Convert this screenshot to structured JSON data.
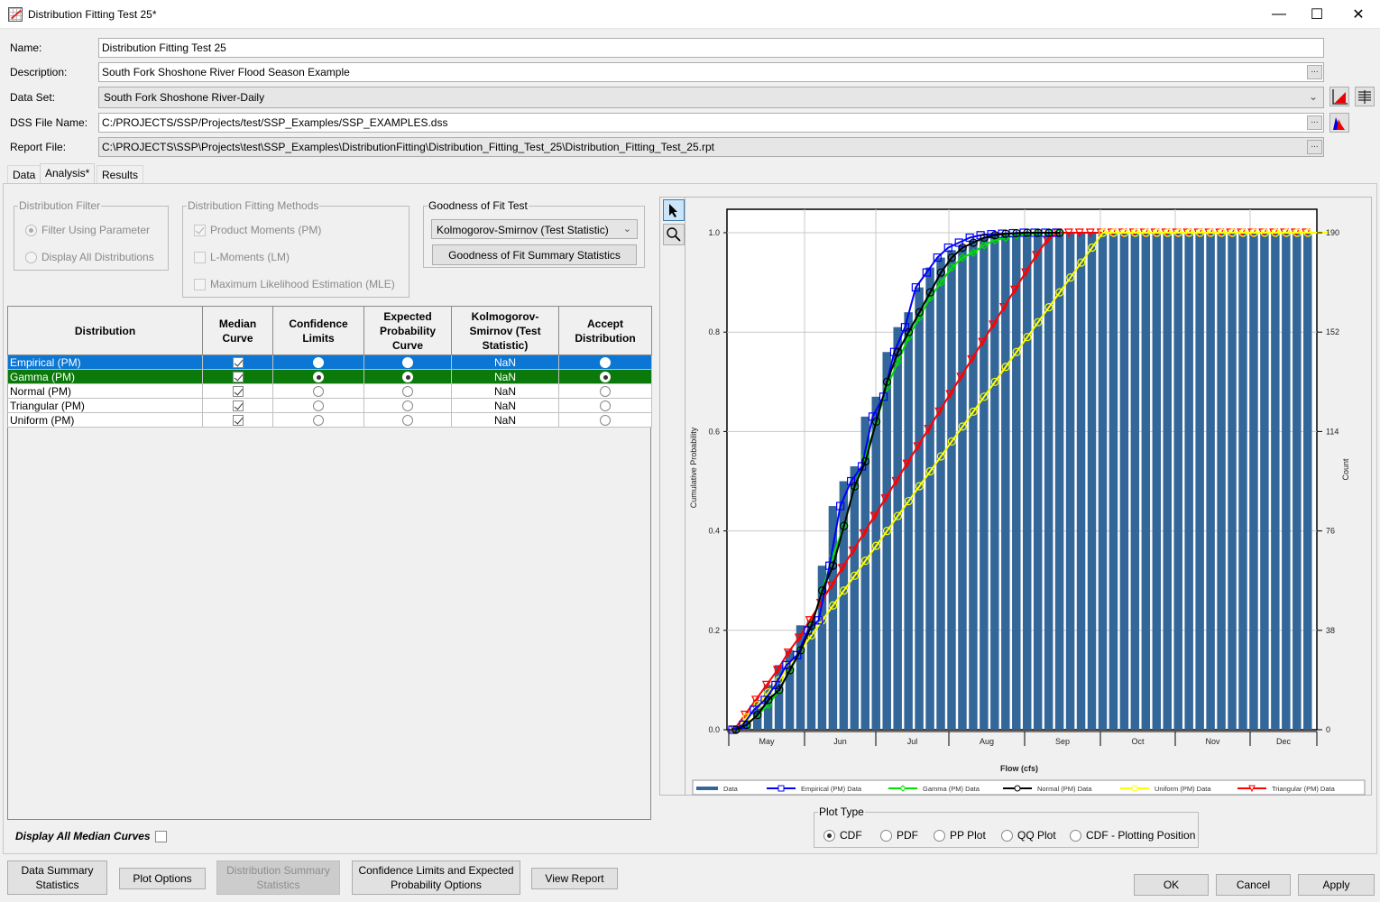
{
  "window": {
    "title": "Distribution Fitting Test 25*",
    "minimize": "—",
    "maximize": "☐",
    "close": "✕"
  },
  "form": {
    "name_label": "Name:",
    "name_value": "Distribution Fitting Test 25",
    "description_label": "Description:",
    "description_value": "South Fork Shoshone River Flood Season Example",
    "dataset_label": "Data Set:",
    "dataset_value": "South Fork Shoshone River-Daily",
    "dss_label": "DSS File Name:",
    "dss_value": "C:/PROJECTS/SSP/Projects/test/SSP_Examples/SSP_EXAMPLES.dss",
    "report_label": "Report File:",
    "report_value": "C:\\PROJECTS\\SSP\\Projects\\test\\SSP_Examples\\DistributionFitting\\Distribution_Fitting_Test_25\\Distribution_Fitting_Test_25.rpt",
    "ellipsis": "..."
  },
  "tabs": [
    {
      "label": "Data",
      "active": false
    },
    {
      "label": "Analysis*",
      "active": true
    },
    {
      "label": "Results",
      "active": false
    }
  ],
  "distribution_filter": {
    "legend": "Distribution Filter",
    "options": [
      {
        "label": "Filter Using Parameter",
        "selected": true
      },
      {
        "label": "Display All Distributions",
        "selected": false
      }
    ]
  },
  "fitting_methods": {
    "legend": "Distribution Fitting Methods",
    "options": [
      {
        "label": "Product Moments (PM)",
        "checked": true
      },
      {
        "label": "L-Moments (LM)",
        "checked": false
      },
      {
        "label": "Maximum Likelihood Estimation (MLE)",
        "checked": false
      }
    ]
  },
  "goodness_of_fit": {
    "legend": "Goodness of Fit Test",
    "selected_test": "Kolmogorov-Smirnov (Test Statistic)",
    "summary_button": "Goodness of Fit Summary Statistics"
  },
  "table": {
    "headers": [
      "Distribution",
      "Median Curve",
      "Confidence Limits",
      "Expected Probability Curve",
      "Kolmogorov-Smirnov (Test Statistic)",
      "Accept Distribution"
    ],
    "rows": [
      {
        "distribution": "Empirical (PM)",
        "median": true,
        "confidence": false,
        "expected": false,
        "ks": "NaN",
        "accept": false,
        "highlight": "blue"
      },
      {
        "distribution": "Gamma (PM)",
        "median": true,
        "confidence": true,
        "expected": true,
        "ks": "NaN",
        "accept": true,
        "highlight": "green"
      },
      {
        "distribution": "Normal (PM)",
        "median": true,
        "confidence": false,
        "expected": false,
        "ks": "NaN",
        "accept": false,
        "highlight": ""
      },
      {
        "distribution": "Triangular (PM)",
        "median": true,
        "confidence": false,
        "expected": false,
        "ks": "NaN",
        "accept": false,
        "highlight": ""
      },
      {
        "distribution": "Uniform (PM)",
        "median": true,
        "confidence": false,
        "expected": false,
        "ks": "NaN",
        "accept": false,
        "highlight": ""
      }
    ]
  },
  "display_all_median": {
    "label": "Display All Median Curves",
    "checked": false
  },
  "bottom_buttons": {
    "data_summary": "Data Summary Statistics",
    "plot_options": "Plot Options",
    "distribution_summary": "Distribution Summary Statistics",
    "confidence_limits": "Confidence Limits and Expected Probability Options",
    "view_report": "View Report"
  },
  "plot_type": {
    "legend": "Plot Type",
    "options": [
      {
        "label": "CDF",
        "selected": true
      },
      {
        "label": "PDF",
        "selected": false
      },
      {
        "label": "PP Plot",
        "selected": false
      },
      {
        "label": "QQ Plot",
        "selected": false
      },
      {
        "label": "CDF - Plotting Position",
        "selected": false
      }
    ]
  },
  "dialog_buttons": {
    "ok": "OK",
    "cancel": "Cancel",
    "apply": "Apply"
  },
  "chart_data": {
    "type": "line",
    "title": "",
    "xlabel": "Flow (cfs)",
    "ylabel": "Cumulative Probability",
    "y2label": "Count",
    "ylim": [
      0,
      1.0
    ],
    "y2lim": [
      0,
      190
    ],
    "yticks": [
      "0.0",
      "0.2",
      "0.4",
      "0.6",
      "0.8",
      "1.0"
    ],
    "y2ticks": [
      "0",
      "38",
      "76",
      "114",
      "152",
      "190"
    ],
    "xticks": [
      "May",
      "Jun",
      "Jul",
      "Aug",
      "Sep",
      "Oct",
      "Nov",
      "Dec"
    ],
    "grid": true,
    "legend_position": "bottom",
    "colors": {
      "bars": "#336699",
      "empirical": "#0000ff",
      "gamma": "#00e000",
      "normal": "#000000",
      "uniform": "#ffff00",
      "triangular": "#ff0000"
    },
    "legend": [
      "Data",
      "Empirical (PM) Data",
      "Gamma (PM) Data",
      "Normal (PM) Data",
      "Uniform (PM) Data",
      "Triangular (PM) Data"
    ],
    "bars": {
      "name": "Data",
      "count": 54,
      "cumulative_probability": [
        0.0,
        0.02,
        0.06,
        0.09,
        0.13,
        0.16,
        0.21,
        0.22,
        0.33,
        0.45,
        0.5,
        0.53,
        0.63,
        0.67,
        0.76,
        0.81,
        0.84,
        0.89,
        0.93,
        0.95,
        0.965,
        0.975,
        0.985,
        0.99,
        0.995,
        0.997,
        0.998,
        0.999,
        1.0,
        1.0,
        1.0,
        1.0,
        1.0,
        1.0,
        1.0,
        1.0,
        1.0,
        1.0,
        1.0,
        1.0,
        1.0,
        1.0,
        1.0,
        1.0,
        1.0,
        1.0,
        1.0,
        1.0,
        1.0,
        1.0,
        1.0,
        1.0,
        1.0,
        1.0
      ]
    },
    "series": [
      {
        "name": "Empirical (PM) Data",
        "marker": "square",
        "values": [
          0.0,
          0.01,
          0.04,
          0.06,
          0.09,
          0.13,
          0.15,
          0.2,
          0.22,
          0.33,
          0.45,
          0.5,
          0.53,
          0.63,
          0.67,
          0.76,
          0.81,
          0.89,
          0.92,
          0.95,
          0.97,
          0.98,
          0.99,
          0.995,
          0.997,
          0.998,
          0.999,
          1.0,
          1.0,
          1.0,
          1.0
        ]
      },
      {
        "name": "Gamma (PM) Data",
        "marker": "diamond",
        "values": [
          0.0,
          0.01,
          0.03,
          0.05,
          0.08,
          0.12,
          0.16,
          0.21,
          0.28,
          0.35,
          0.41,
          0.49,
          0.55,
          0.62,
          0.69,
          0.74,
          0.79,
          0.83,
          0.87,
          0.9,
          0.93,
          0.95,
          0.96,
          0.975,
          0.985,
          0.99,
          0.995,
          0.997,
          0.999,
          1.0,
          1.0
        ]
      },
      {
        "name": "Normal (PM) Data",
        "marker": "circle",
        "values": [
          0.0,
          0.01,
          0.03,
          0.06,
          0.08,
          0.12,
          0.16,
          0.21,
          0.28,
          0.33,
          0.41,
          0.49,
          0.54,
          0.62,
          0.7,
          0.76,
          0.8,
          0.84,
          0.88,
          0.92,
          0.95,
          0.97,
          0.98,
          0.99,
          0.995,
          0.998,
          0.999,
          1.0,
          1.0,
          1.0,
          1.0
        ]
      },
      {
        "name": "Uniform (PM) Data",
        "marker": "circle",
        "values": [
          0.0,
          0.025,
          0.05,
          0.075,
          0.1,
          0.13,
          0.16,
          0.19,
          0.22,
          0.25,
          0.28,
          0.31,
          0.34,
          0.37,
          0.4,
          0.43,
          0.46,
          0.49,
          0.52,
          0.55,
          0.58,
          0.61,
          0.64,
          0.67,
          0.7,
          0.73,
          0.76,
          0.79,
          0.82,
          0.85,
          0.88,
          0.91,
          0.94,
          0.97,
          1.0,
          1.0,
          1.0,
          1.0,
          1.0,
          1.0,
          1.0,
          1.0,
          1.0,
          1.0,
          1.0,
          1.0,
          1.0,
          1.0,
          1.0,
          1.0,
          1.0,
          1.0,
          1.0,
          1.0,
          1.0,
          1.0
        ]
      },
      {
        "name": "Triangular (PM) Data",
        "marker": "triangle-down",
        "values": [
          0.0,
          0.03,
          0.06,
          0.09,
          0.12,
          0.155,
          0.185,
          0.22,
          0.255,
          0.29,
          0.325,
          0.36,
          0.395,
          0.43,
          0.465,
          0.5,
          0.535,
          0.57,
          0.605,
          0.64,
          0.675,
          0.71,
          0.745,
          0.78,
          0.815,
          0.85,
          0.885,
          0.92,
          0.955,
          0.985,
          1.0,
          1.0,
          1.0,
          1.0,
          1.0,
          1.0,
          1.0,
          1.0,
          1.0,
          1.0,
          1.0,
          1.0,
          1.0,
          1.0,
          1.0,
          1.0,
          1.0,
          1.0,
          1.0,
          1.0,
          1.0,
          1.0,
          1.0,
          1.0,
          1.0,
          1.0
        ]
      }
    ]
  }
}
